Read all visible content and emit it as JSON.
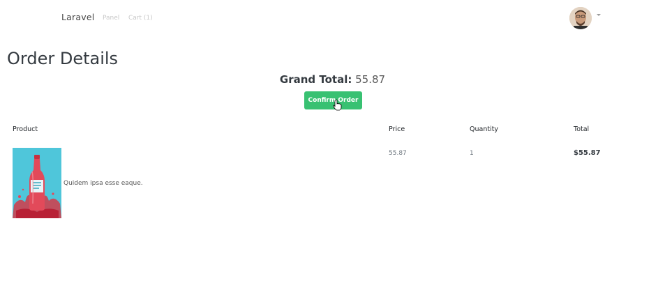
{
  "navbar": {
    "brand": "Laravel",
    "links": [
      "Panel",
      "Cart (1)"
    ]
  },
  "page": {
    "title": "Order Details",
    "grand_total_label": "Grand Total:",
    "grand_total_value": "55.87",
    "confirm_label": "Confirm Order"
  },
  "table": {
    "headers": [
      "Product",
      "Price",
      "Quantity",
      "Total"
    ],
    "rows": [
      {
        "product": "Quidem ipsa esse eaque.",
        "price": "55.87",
        "quantity": "1",
        "total": "$55.87"
      }
    ]
  },
  "colors": {
    "accent": "#38c172",
    "product_bg": "#54c8dc"
  }
}
